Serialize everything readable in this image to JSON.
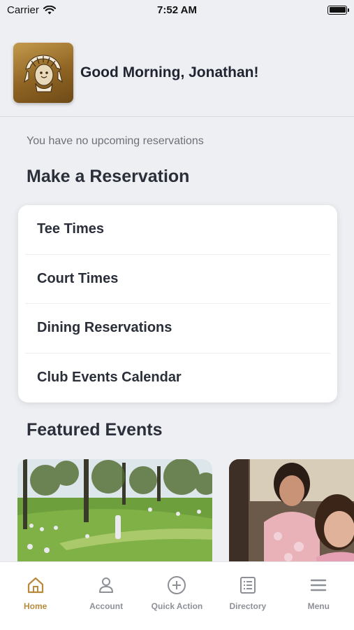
{
  "status_bar": {
    "carrier": "Carrier",
    "time": "7:52 AM"
  },
  "header": {
    "greeting": "Good Morning, Jonathan!"
  },
  "reservations": {
    "empty_text": "You have no upcoming reservations"
  },
  "make_reservation": {
    "title": "Make a Reservation",
    "items": [
      {
        "label": "Tee Times"
      },
      {
        "label": "Court Times"
      },
      {
        "label": "Dining Reservations"
      },
      {
        "label": "Club Events Calendar"
      }
    ]
  },
  "featured": {
    "title": "Featured Events"
  },
  "tabs": [
    {
      "label": "Home",
      "icon": "home-icon",
      "active": true
    },
    {
      "label": "Account",
      "icon": "person-icon"
    },
    {
      "label": "Quick Action",
      "icon": "plus-circle-icon"
    },
    {
      "label": "Directory",
      "icon": "list-icon"
    },
    {
      "label": "Menu",
      "icon": "hamburger-icon"
    }
  ],
  "colors": {
    "accent": "#b98a3c",
    "background": "#eeeff3",
    "inactive": "#8e9098"
  }
}
